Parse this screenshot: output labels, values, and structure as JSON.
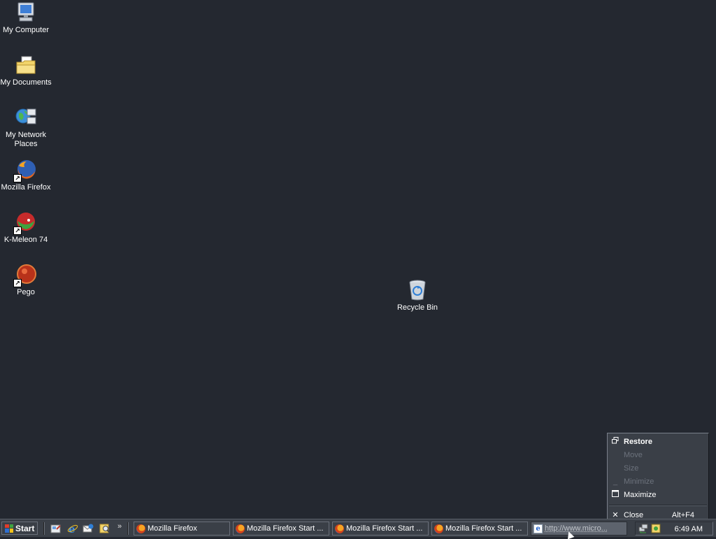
{
  "desktop": {
    "icons": [
      {
        "label": "My Computer",
        "icon": "my-computer-icon"
      },
      {
        "label": "My Documents",
        "icon": "my-documents-icon"
      },
      {
        "label": "My Network Places",
        "icon": "network-places-icon"
      },
      {
        "label": "Mozilla Firefox",
        "icon": "firefox-icon"
      },
      {
        "label": "K-Meleon 74",
        "icon": "k-meleon-icon"
      },
      {
        "label": "Pego",
        "icon": "pego-icon"
      },
      {
        "label": "Recycle Bin",
        "icon": "recycle-bin-icon"
      }
    ],
    "background_color": "#242830"
  },
  "taskbar": {
    "start_label": "Start",
    "quick_launch": [
      "show-desktop-icon",
      "internet-explorer-icon",
      "outlook-express-icon",
      "search-icon"
    ],
    "overflow_label": "»",
    "tasks": [
      {
        "label": "Mozilla Firefox",
        "icon": "firefox-icon"
      },
      {
        "label": "Mozilla Firefox Start ...",
        "icon": "firefox-icon"
      },
      {
        "label": "Mozilla Firefox Start ...",
        "icon": "firefox-icon"
      },
      {
        "label": "Mozilla Firefox Start ...",
        "icon": "firefox-icon"
      },
      {
        "label": "http://www.micro...",
        "icon": "internet-explorer-icon",
        "active": true
      }
    ],
    "clock": "6:49 AM"
  },
  "context_menu": {
    "items": [
      {
        "label": "Restore",
        "icon": "restore-icon",
        "enabled": true,
        "default": true
      },
      {
        "label": "Move",
        "enabled": false
      },
      {
        "label": "Size",
        "enabled": false
      },
      {
        "label": "Minimize",
        "icon": "minimize-icon",
        "enabled": false
      },
      {
        "label": "Maximize",
        "icon": "maximize-icon",
        "enabled": true
      }
    ],
    "close": {
      "label": "Close",
      "accelerator": "Alt+F4",
      "icon": "close-icon"
    }
  }
}
